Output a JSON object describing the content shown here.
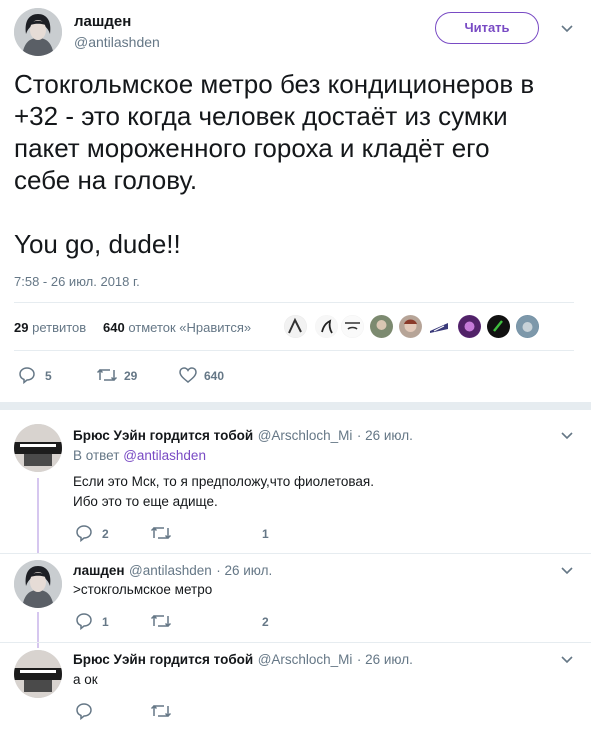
{
  "main_tweet": {
    "author_name": "лашден",
    "author_handle": "@antilashden",
    "follow_label": "Читать",
    "text_lines": [
      "Стокгольмское метро без кондиционеров в",
      "+32 - это когда человек достаёт из сумки",
      "пакет мороженного гороха и кладёт его",
      "себе на голову."
    ],
    "text_tail": "You go, dude!!",
    "timestamp": "7:58 - 26 июл. 2018 г.",
    "retweets_count": "29",
    "retweets_label": "ретвитов",
    "likes_count": "640",
    "likes_label": "отметок «Нравится»",
    "actions": {
      "reply_count": "5",
      "retweet_count": "29",
      "like_count": "640"
    }
  },
  "replies": [
    {
      "author_name": "Брюс Уэйн гордится тобой",
      "author_handle": "@Arschloch_Mi",
      "date": "· 26 июл.",
      "reply_to_prefix": "В ответ",
      "reply_to_handle": "@antilashden",
      "text_lines": [
        "Если это Мск, то я предположу,что фиолетовая.",
        "Ибо это то еще адище."
      ],
      "reply_count": "2",
      "retweet_count": "",
      "like_count": "1"
    },
    {
      "author_name": "лашден",
      "author_handle": "@antilashden",
      "date": "· 26 июл.",
      "text_lines": [
        ">стокгольмское метро"
      ],
      "reply_count": "1",
      "retweet_count": "",
      "like_count": "2"
    },
    {
      "author_name": "Брюс Уэйн гордится тобой",
      "author_handle": "@Arschloch_Mi",
      "date": "· 26 июл.",
      "text_lines": [
        "а ок"
      ],
      "reply_count": "",
      "retweet_count": "",
      "like_count": ""
    }
  ],
  "colors": {
    "accent": "#794bc4",
    "muted": "#657786",
    "text": "#14171a",
    "thread": "#d6c7ef"
  },
  "icons": [
    "chevron-down-icon",
    "reply-icon",
    "retweet-icon",
    "like-icon"
  ]
}
